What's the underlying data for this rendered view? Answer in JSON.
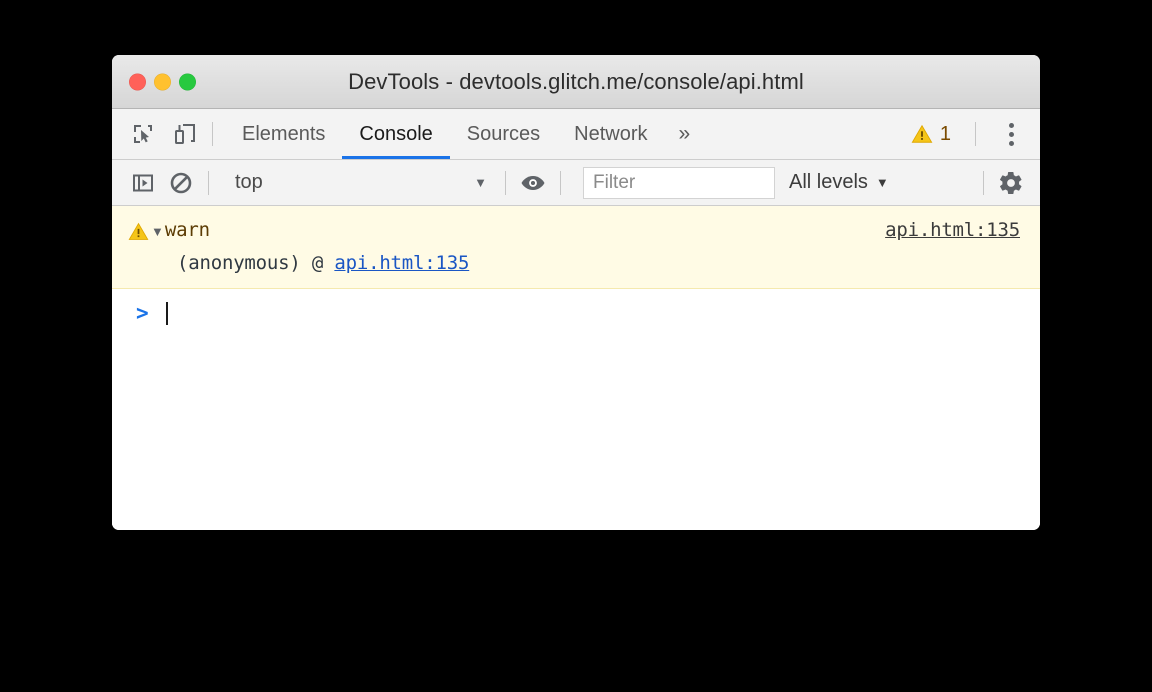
{
  "window": {
    "title": "DevTools - devtools.glitch.me/console/api.html",
    "traffic_lights": [
      {
        "name": "close",
        "color": "#ff6159"
      },
      {
        "name": "minimize",
        "color": "#ffc12f"
      },
      {
        "name": "zoom",
        "color": "#27c93f"
      }
    ]
  },
  "tabbar": {
    "icons": [
      {
        "name": "inspect-element-icon"
      },
      {
        "name": "device-toolbar-icon"
      }
    ],
    "tabs": [
      {
        "label": "Elements",
        "active": false
      },
      {
        "label": "Console",
        "active": true
      },
      {
        "label": "Sources",
        "active": false
      },
      {
        "label": "Network",
        "active": false
      }
    ],
    "more_tabs_label": "»",
    "warning_count": "1",
    "warning_icon": "warning-triangle-icon",
    "menu_icon": "kebab-menu-icon",
    "active_tab_underline_color": "#1a73e8"
  },
  "console_toolbar": {
    "sidebar_toggle_icon": "console-sidebar-toggle-icon",
    "clear_icon": "clear-console-icon",
    "context": {
      "value": "top",
      "caret": "▼"
    },
    "eye_icon": "live-expression-eye-icon",
    "filter": {
      "value": "",
      "placeholder": "Filter"
    },
    "levels": {
      "label": "All levels",
      "caret": "▼"
    },
    "settings_icon": "settings-gear-icon"
  },
  "console_messages": [
    {
      "type": "warning",
      "icon": "warning-triangle-icon",
      "disclosure": "▼",
      "text": "warn",
      "source_link": "api.html:135",
      "stack": {
        "frame": "(anonymous) @ ",
        "link": "api.html:135"
      },
      "background": "#fffbe5",
      "text_color": "#5c3c04"
    }
  ],
  "prompt": {
    "chevron": ">",
    "value": "",
    "caret_visible": true
  }
}
